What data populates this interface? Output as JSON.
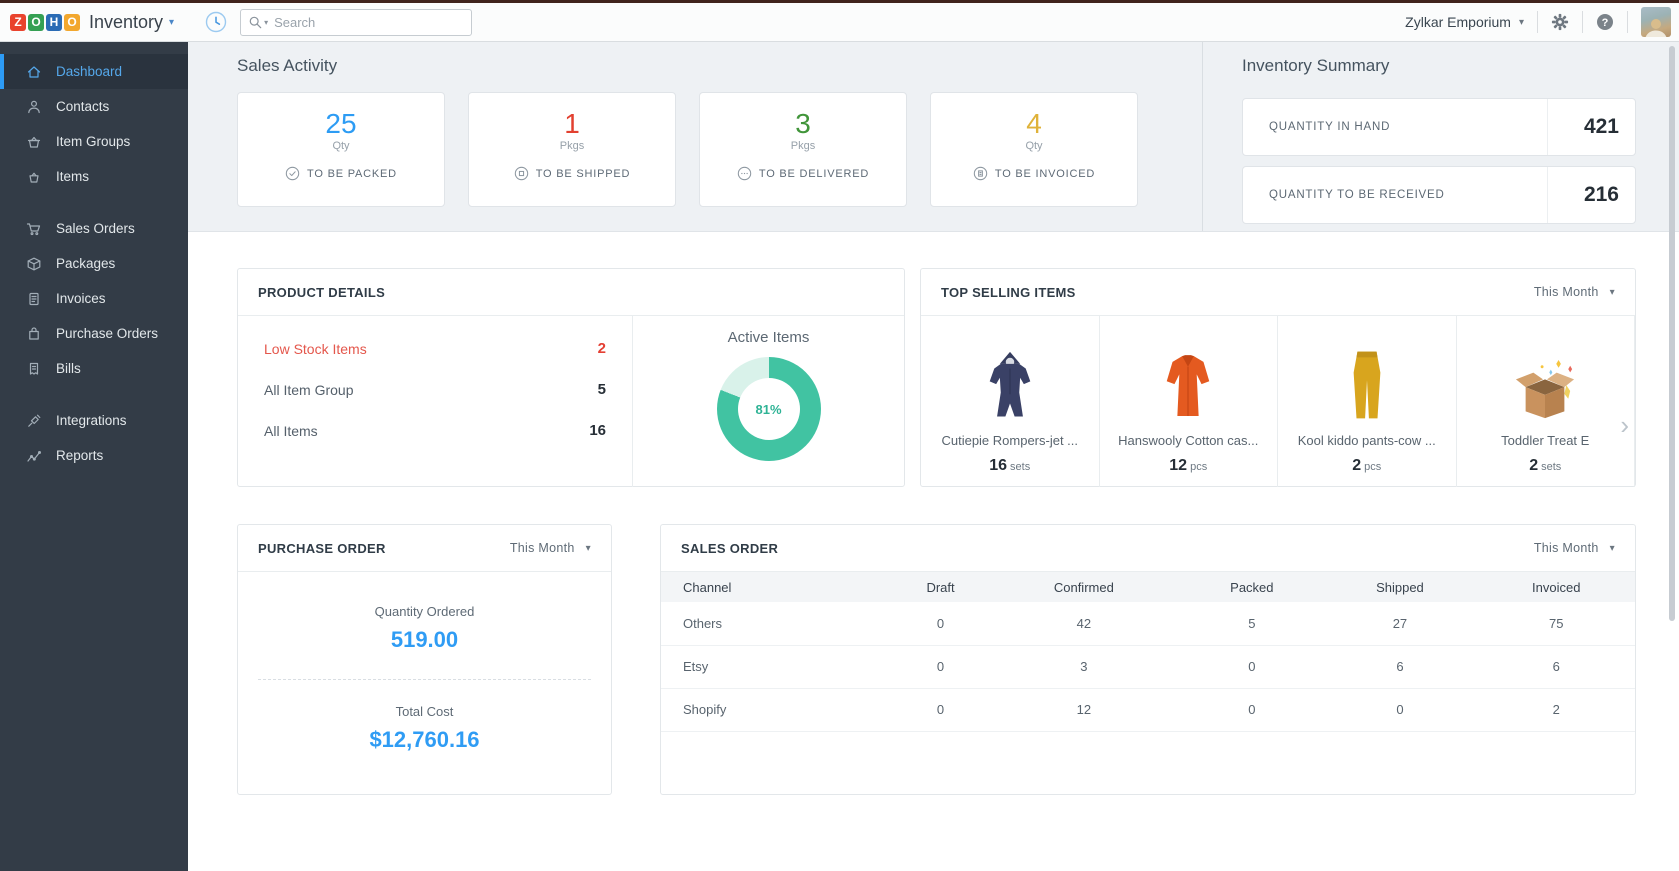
{
  "ui": {
    "caret_down": "▾",
    "chevron_right": "›",
    "help_glyph": "?"
  },
  "topbar": {
    "logo_letters": [
      {
        "ch": "Z",
        "bg": "#e9432d"
      },
      {
        "ch": "O",
        "bg": "#35a053"
      },
      {
        "ch": "H",
        "bg": "#2b6cb5"
      },
      {
        "ch": "O",
        "bg": "#f2a72e"
      }
    ],
    "product": "Inventory",
    "search_placeholder": "Search",
    "org": "Zylkar Emporium",
    "icons": [
      "history-icon",
      "search-icon",
      "gear-icon",
      "help-icon",
      "avatar"
    ]
  },
  "sidebar": {
    "items": [
      {
        "label": "Dashboard",
        "icon": "home-icon",
        "active": true
      },
      {
        "label": "Contacts",
        "icon": "person-icon"
      },
      {
        "label": "Item Groups",
        "icon": "basket-group-icon"
      },
      {
        "label": "Items",
        "icon": "basket-icon"
      },
      {
        "label": "Sales Orders",
        "icon": "cart-icon"
      },
      {
        "label": "Packages",
        "icon": "package-icon"
      },
      {
        "label": "Invoices",
        "icon": "invoice-icon"
      },
      {
        "label": "Purchase Orders",
        "icon": "purchase-bag-icon"
      },
      {
        "label": "Bills",
        "icon": "bill-icon"
      },
      {
        "label": "Integrations",
        "icon": "plug-icon"
      },
      {
        "label": "Reports",
        "icon": "report-graph-icon"
      }
    ]
  },
  "sales_activity": {
    "title": "Sales Activity",
    "cards": [
      {
        "value": "25",
        "unit": "Qty",
        "label": "TO BE PACKED",
        "color": "#2d9cf4",
        "icon": "check-circle-icon"
      },
      {
        "value": "1",
        "unit": "Pkgs",
        "label": "TO BE SHIPPED",
        "color": "#e2402f",
        "icon": "box-circle-icon"
      },
      {
        "value": "3",
        "unit": "Pkgs",
        "label": "TO BE DELIVERED",
        "color": "#41953a",
        "icon": "dots-circle-icon"
      },
      {
        "value": "4",
        "unit": "Qty",
        "label": "TO BE INVOICED",
        "color": "#dfb239",
        "icon": "doc-circle-icon"
      }
    ]
  },
  "inventory_summary": {
    "title": "Inventory Summary",
    "rows": [
      {
        "label": "QUANTITY IN HAND",
        "value": "421"
      },
      {
        "label": "QUANTITY TO BE RECEIVED",
        "value": "216"
      }
    ]
  },
  "product_details": {
    "title": "PRODUCT DETAILS",
    "rows": [
      {
        "label": "Low Stock Items",
        "value": "2"
      },
      {
        "label": "All Item Group",
        "value": "5"
      },
      {
        "label": "All Items",
        "value": "16"
      }
    ],
    "active_items": {
      "label": "Active Items",
      "percent": 81,
      "percent_label": "81%",
      "ring_color": "#41c3a2",
      "ring_rest_color": "#d9f2ea"
    }
  },
  "top_selling": {
    "title": "TOP SELLING ITEMS",
    "period": "This Month",
    "items": [
      {
        "name": "Cutiepie Rompers-jet ...",
        "qty": "16",
        "unit": "sets",
        "image": "romper-image"
      },
      {
        "name": "Hanswooly Cotton cas...",
        "qty": "12",
        "unit": "pcs",
        "image": "cardigan-image"
      },
      {
        "name": "Kool kiddo pants-cow ...",
        "qty": "2",
        "unit": "pcs",
        "image": "pants-image"
      },
      {
        "name": "Toddler Treat E",
        "qty": "2",
        "unit": "sets",
        "image": "giftbox-image"
      }
    ]
  },
  "purchase_order": {
    "title": "PURCHASE ORDER",
    "period": "This Month",
    "metrics": [
      {
        "label": "Quantity Ordered",
        "value": "519.00"
      },
      {
        "label": "Total Cost",
        "value": "$12,760.16"
      }
    ],
    "value_color": "#2f9cf4"
  },
  "sales_order": {
    "title": "SALES ORDER",
    "period": "This Month",
    "columns": [
      "Channel",
      "Draft",
      "Confirmed",
      "Packed",
      "Shipped",
      "Invoiced"
    ],
    "rows": [
      [
        "Others",
        "0",
        "42",
        "5",
        "27",
        "75"
      ],
      [
        "Etsy",
        "0",
        "3",
        "0",
        "6",
        "6"
      ],
      [
        "Shopify",
        "0",
        "12",
        "0",
        "0",
        "2"
      ]
    ]
  }
}
